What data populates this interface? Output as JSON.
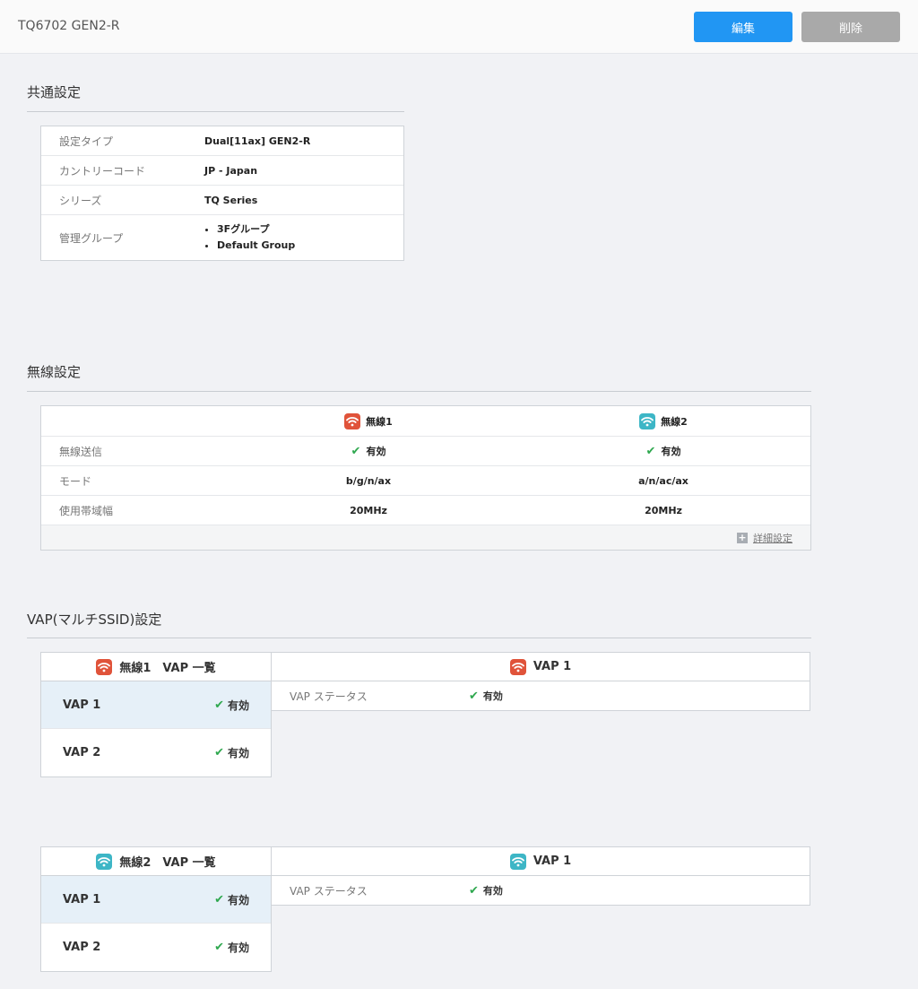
{
  "header": {
    "title": "TQ6702 GEN2-R",
    "edit_label": "編集",
    "delete_label": "削除"
  },
  "common": {
    "title": "共通設定",
    "rows": [
      {
        "key": "設定タイプ",
        "value": "Dual[11ax] GEN2-R"
      },
      {
        "key": "カントリーコード",
        "value": "JP - Japan"
      },
      {
        "key": "シリーズ",
        "value": "TQ Series"
      }
    ],
    "group_key": "管理グループ",
    "groups": [
      "3Fグループ",
      "Default Group"
    ]
  },
  "wireless": {
    "title": "無線設定",
    "radio1": "無線1",
    "radio2": "無線2",
    "rows": [
      {
        "key": "無線送信",
        "v1": "有効",
        "v2": "有効"
      },
      {
        "key": "モード",
        "v1": "b/g/n/ax",
        "v2": "a/n/ac/ax"
      },
      {
        "key": "使用帯域幅",
        "v1": "20MHz",
        "v2": "20MHz"
      }
    ],
    "detail_link": "詳細設定"
  },
  "vap": {
    "title": "VAP(マルチSSID)設定",
    "panels": [
      {
        "list_title": "無線1　VAP 一覧",
        "items": [
          {
            "label": "VAP 1",
            "status": "有効"
          },
          {
            "label": "VAP 2",
            "status": "有効"
          }
        ],
        "detail_title": "VAP 1",
        "detail_key": "VAP ステータス",
        "detail_value": "有効"
      },
      {
        "list_title": "無線2　VAP 一覧",
        "items": [
          {
            "label": "VAP 1",
            "status": "有効"
          },
          {
            "label": "VAP 2",
            "status": "有効"
          }
        ],
        "detail_title": "VAP 1",
        "detail_key": "VAP ステータス",
        "detail_value": "有効"
      }
    ]
  },
  "colors": {
    "primary": "#2196f3",
    "disabled": "#a9a9a9",
    "radio1": "#e0533a",
    "radio2": "#3db6c6",
    "enabled": "#2fa84f"
  },
  "icons": {
    "radio1": "wifi-icon",
    "radio2": "wifi-icon",
    "enabled": "check-icon",
    "expand": "plus-icon"
  }
}
